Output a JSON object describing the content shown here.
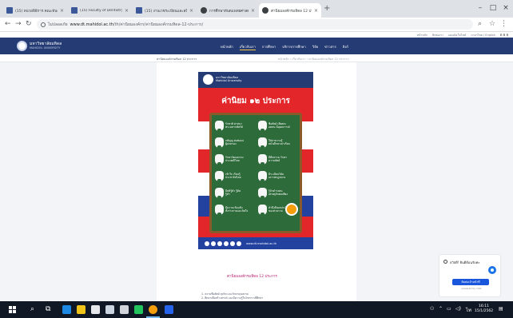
{
  "browser": {
    "tabs": [
      {
        "title": "(15) หน่วยพิธีการ คณะทันตแพทยศาส…",
        "favicon": "facebook-icon",
        "active": false
      },
      {
        "title": "(15) Faculty of Dentistry, Mahidol …",
        "favicon": "facebook-icon",
        "active": false
      },
      {
        "title": "(15) งานเวชระเบียนและสถิติ คณะทันตแพทย…",
        "favicon": "facebook-icon",
        "active": false
      },
      {
        "title": "การศึกษาทันตแพทยศาสตร์ คณะทัน…",
        "favicon": "globe-icon",
        "active": false
      },
      {
        "title": "ค่านิยมองค์กรมหิดล 12 ประการ – มหาวิ…",
        "favicon": "globe-icon",
        "active": true
      }
    ],
    "url_security": "ไม่ปลอดภัย",
    "url_host": "www.dt.mahidol.ac.th",
    "url_path": "/th/ค่านิยมองค์กร/ค่านิยมองค์กรมหิดล-12-ประการ/"
  },
  "page": {
    "utility_links": [
      "หน้าหลัก",
      "ติดต่อเรา",
      "แผนผังเว็บไซต์",
      "ภาษาไทย | English"
    ],
    "font_controls": "ก ก ก",
    "site_name": "มหาวิทยาลัยมหิดล",
    "site_sub": "MAHIDOL UNIVERSITY",
    "nav": [
      "หน้าหลัก",
      "เกี่ยวกับเรา",
      "การศึกษา",
      "บริการการศึกษา",
      "วิจัย",
      "ข่าวสาร",
      "ลิงก์"
    ],
    "nav_active_index": 1,
    "crumb_title": "ค่านิยมองค์กรมหิดล 12 ประการ",
    "crumb_path": "หน้าหลัก › เกี่ยวกับเรา › ค่านิยมองค์กรมหิดล 12 ประการ",
    "poster": {
      "org": "มหาวิทยาลัยมหิดล",
      "org_sub": "Mahidol University",
      "title": "ค่านิยม ๑๒ ประการ",
      "values": [
        "รักชาติ ศาสนา\nพระมหากษัตริย์",
        "ซื่อสัตย์ เสียสละ\nอดทน มีอุดมการณ์",
        "กตัญญู ต่อพ่อแม่\nผู้ปกครอง",
        "ใฝ่หาความรู้\nหมั่นศึกษาเล่าเรียน",
        "รักษาวัฒนธรรม\nประเพณีไทย",
        "มีศีลธรรม รักษา\nความสัตย์",
        "เข้าใจ เรียนรู้\nประชาธิปไตย",
        "มีระเบียบวินัย\nเคารพกฎหมาย",
        "มีสติรู้ตัว รู้คิด\nรู้ทำ",
        "รู้จักดำรงตน\nเศรษฐกิจพอเพียง",
        "มีความเข้มแข็ง\nทั้งร่างกายและจิตใจ",
        "คำนึงถึงผลประโยชน์\nของส่วนรวม"
      ],
      "url": "www.dt.mahidol.ac.th"
    },
    "caption": "ค่านิยมองค์กรมหิดล 12 ประการ",
    "list": [
      "1. ความซื่อสัตย์ สุจริต และรักษาคุณธรรม",
      "2. ศึกษาเพื่อสร้างสรรค์ และมีความรู้ในวิชาการที่ศึกษา"
    ]
  },
  "chat": {
    "option_label": "สวัสดี! ยินดีต้อนรับค่ะ",
    "button": "ติดต่อเจ้าหน้าที่",
    "meta": "powered by chat"
  },
  "taskbar": {
    "time": "16:11",
    "date": "15/1/2562"
  }
}
